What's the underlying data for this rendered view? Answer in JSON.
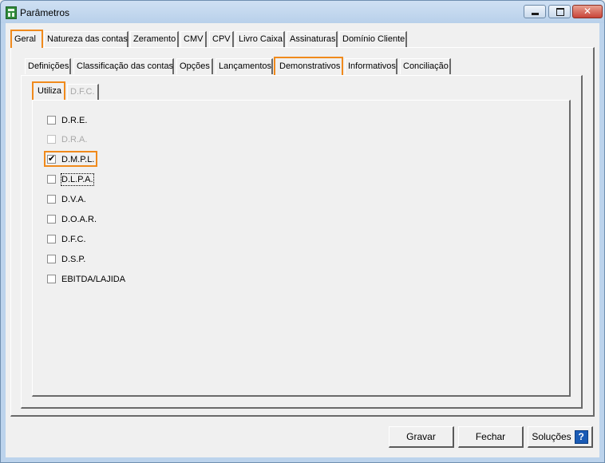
{
  "window": {
    "title": "Parâmetros",
    "controls": {
      "close_glyph": "✕"
    }
  },
  "main_tabs": [
    {
      "label": "Geral"
    },
    {
      "label": "Natureza das contas"
    },
    {
      "label": "Zeramento"
    },
    {
      "label": "CMV"
    },
    {
      "label": "CPV"
    },
    {
      "label": "Livro Caixa"
    },
    {
      "label": "Assinaturas"
    },
    {
      "label": "Domínio Cliente"
    }
  ],
  "sub_tabs": [
    {
      "label": "Definições"
    },
    {
      "label": "Classificação das contas"
    },
    {
      "label": "Opções"
    },
    {
      "label": "Lançamentos"
    },
    {
      "label": "Demonstrativos"
    },
    {
      "label": "Informativos"
    },
    {
      "label": "Conciliação"
    }
  ],
  "inner_tabs": [
    {
      "label": "Utiliza"
    },
    {
      "label": "D.F.C."
    }
  ],
  "checkboxes": [
    {
      "label": "D.R.E.",
      "checked": false,
      "enabled": true
    },
    {
      "label": "D.R.A.",
      "checked": false,
      "enabled": false
    },
    {
      "label": "D.M.P.L.",
      "checked": true,
      "enabled": true
    },
    {
      "label": "D.L.P.A.",
      "checked": false,
      "enabled": true
    },
    {
      "label": "D.V.A.",
      "checked": false,
      "enabled": true
    },
    {
      "label": "D.O.A.R.",
      "checked": false,
      "enabled": true
    },
    {
      "label": "D.F.C.",
      "checked": false,
      "enabled": true
    },
    {
      "label": "D.S.P.",
      "checked": false,
      "enabled": true
    },
    {
      "label": "EBITDA/LAJIDA",
      "checked": false,
      "enabled": true
    }
  ],
  "buttons": {
    "save": "Gravar",
    "close": "Fechar",
    "solutions": "Soluções",
    "help_glyph": "?"
  },
  "colors": {
    "highlight": "#f08a1c",
    "help_icon": "#1a5bb5"
  }
}
